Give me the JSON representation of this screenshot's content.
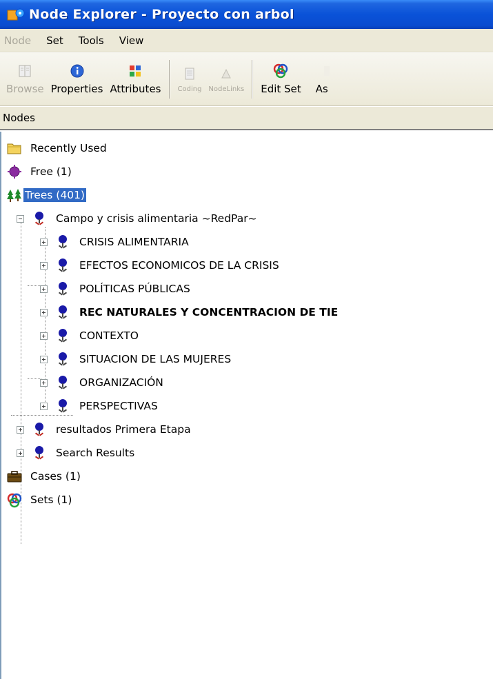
{
  "window": {
    "title": "Node Explorer - Proyecto con arbol"
  },
  "menu": [
    {
      "label": "Node",
      "enabled": false
    },
    {
      "label": "Set",
      "enabled": true
    },
    {
      "label": "Tools",
      "enabled": true
    },
    {
      "label": "View",
      "enabled": true
    }
  ],
  "toolbar": {
    "browse": "Browse",
    "properties": "Properties",
    "attributes": "Attributes",
    "disabled1": "Coding",
    "disabled2": "NodeLinks",
    "edit_set": "Edit Set",
    "partial": "As"
  },
  "panel": {
    "header": "Nodes"
  },
  "tree": {
    "recently_used": "Recently Used",
    "free": "Free (1)",
    "trees": "Trees (401)",
    "root": "Campo y crisis alimentaria ~RedPar~",
    "children": [
      "CRISIS ALIMENTARIA",
      "EFECTOS ECONOMICOS DE LA CRISIS",
      "POLÍTICAS PÚBLICAS",
      "REC NATURALES Y CONCENTRACION DE TIE",
      "CONTEXTO",
      "SITUACION DE LAS MUJERES",
      "ORGANIZACIÓN",
      "PERSPECTIVAS"
    ],
    "resultados": "resultados Primera Etapa",
    "search_results": "Search Results",
    "cases": "Cases (1)",
    "sets": "Sets (1)"
  },
  "colors": {
    "titlebar": "#0a52d8",
    "selection": "#316ac5",
    "node_blue": "#1a1aa8",
    "free_purple": "#8a2ba0",
    "trees_green": "#1f8a2a",
    "folder_yellow": "#f4d35e"
  }
}
